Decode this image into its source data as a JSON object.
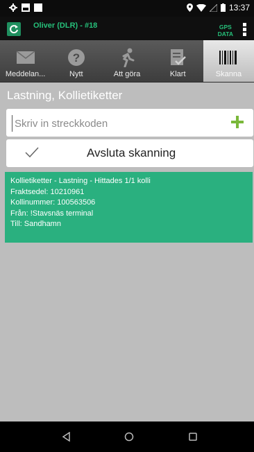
{
  "status_bar": {
    "time": "13:37"
  },
  "app_bar": {
    "title": "Oliver (DLR) - #18",
    "gps_line1": "GPS",
    "gps_line2": "DATA"
  },
  "tabs": [
    {
      "label": "Meddelan...",
      "icon": "envelope-icon",
      "active": false
    },
    {
      "label": "Nytt",
      "icon": "question-icon",
      "active": false
    },
    {
      "label": "Att göra",
      "icon": "walker-icon",
      "active": false
    },
    {
      "label": "Klart",
      "icon": "checklist-icon",
      "active": false
    },
    {
      "label": "Skanna",
      "icon": "barcode-icon",
      "active": true
    }
  ],
  "main": {
    "title": "Lastning, Kollietiketter",
    "barcode_placeholder": "Skriv in streckkoden",
    "finish_label": "Avsluta skanning",
    "info_lines": [
      "Kollietiketter - Lastning - Hittades 1/1 kolli",
      "Fraktsedel: 10210961",
      "Kollinummer: 100563506",
      "Från: !Stavsnäs terminal",
      "Till: Sandhamn"
    ]
  },
  "colors": {
    "accent_green": "#2ab07f",
    "title_green": "#26c07a",
    "plus_green": "#7ab83a"
  }
}
